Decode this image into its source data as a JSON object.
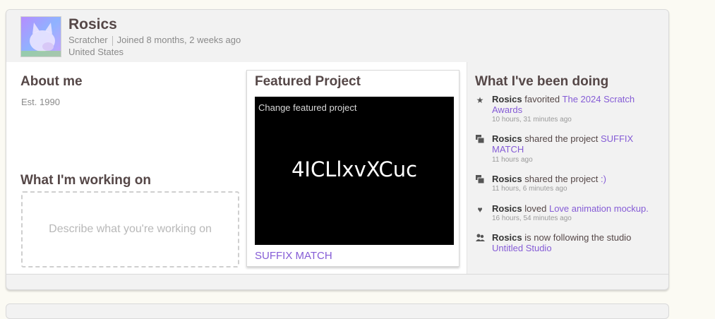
{
  "profile": {
    "username": "Rosics",
    "role": "Scratcher",
    "joined": "Joined 8 months, 2 weeks ago",
    "location": "United States"
  },
  "about": {
    "title": "About me",
    "text": "Est. 1990"
  },
  "working_on": {
    "title": "What I'm working on",
    "placeholder": "Describe what you're working on"
  },
  "featured": {
    "title": "Featured Project",
    "change_label": "Change featured project",
    "thumbnail_text": "4ICLlxvXCuc",
    "project_name": "SUFFIX MATCH"
  },
  "activity": {
    "title": "What I've been doing",
    "items": [
      {
        "icon": "star-icon",
        "user": "Rosics",
        "action": "favorited",
        "target": "The 2024 Scratch Awards",
        "time": "10 hours, 31 minutes ago"
      },
      {
        "icon": "share-icon",
        "user": "Rosics",
        "action": "shared the project",
        "target": "SUFFIX MATCH",
        "time": "11 hours ago"
      },
      {
        "icon": "share-icon",
        "user": "Rosics",
        "action": "shared the project",
        "target": ":)",
        "time": "11 hours, 6 minutes ago"
      },
      {
        "icon": "heart-icon",
        "user": "Rosics",
        "action": "loved",
        "target": "Love animation mockup.",
        "time": "16 hours, 54 minutes ago"
      },
      {
        "icon": "follow-icon",
        "user": "Rosics",
        "action": "is now following the studio",
        "target": "Untitled Studio",
        "time": ""
      }
    ]
  },
  "colors": {
    "link": "#855cd6",
    "heading": "#554747"
  }
}
